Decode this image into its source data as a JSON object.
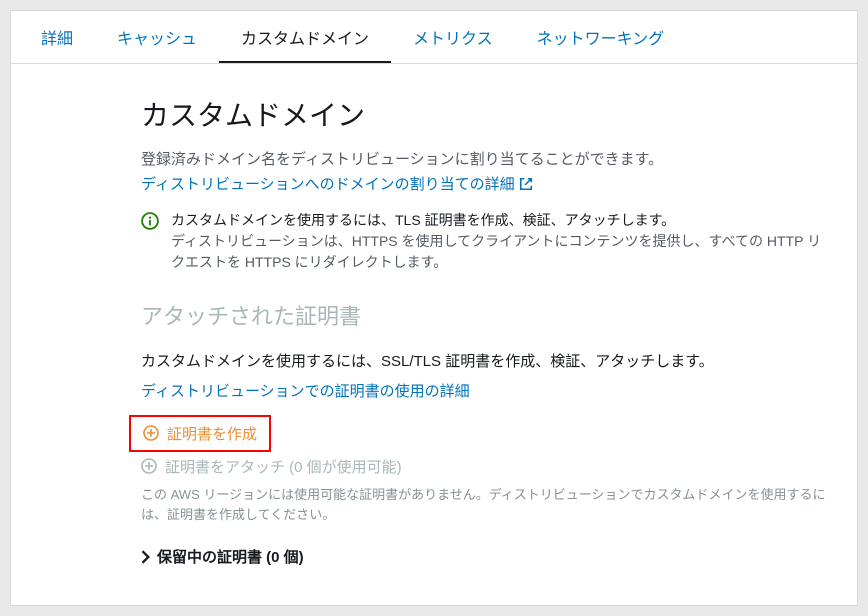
{
  "tabs": [
    {
      "label": "詳細"
    },
    {
      "label": "キャッシュ"
    },
    {
      "label": "カスタムドメイン",
      "active": true
    },
    {
      "label": "メトリクス"
    },
    {
      "label": "ネットワーキング"
    }
  ],
  "heading": "カスタムドメイン",
  "subtitle": "登録済みドメイン名をディストリビューションに割り当てることができます。",
  "assign_link": "ディストリビューションへのドメインの割り当ての詳細",
  "info": {
    "line1": "カスタムドメインを使用するには、TLS 証明書を作成、検証、アタッチします。",
    "line2": "ディストリビューションは、HTTPS を使用してクライアントにコンテンツを提供し、すべての HTTP リクエストを HTTPS にリダイレクトします。"
  },
  "attached_heading": "アタッチされた証明書",
  "attached_desc": "カスタムドメインを使用するには、SSL/TLS 証明書を作成、検証、アタッチします。",
  "cert_link": "ディストリビューションでの証明書の使用の詳細",
  "create_cert": "証明書を作成",
  "attach_cert": "証明書をアタッチ (0 個が使用可能)",
  "footnote": "この AWS リージョンには使用可能な証明書がありません。ディストリビューションでカスタムドメインを使用するには、証明書を作成してください。",
  "pending": "保留中の証明書 (0 個)"
}
